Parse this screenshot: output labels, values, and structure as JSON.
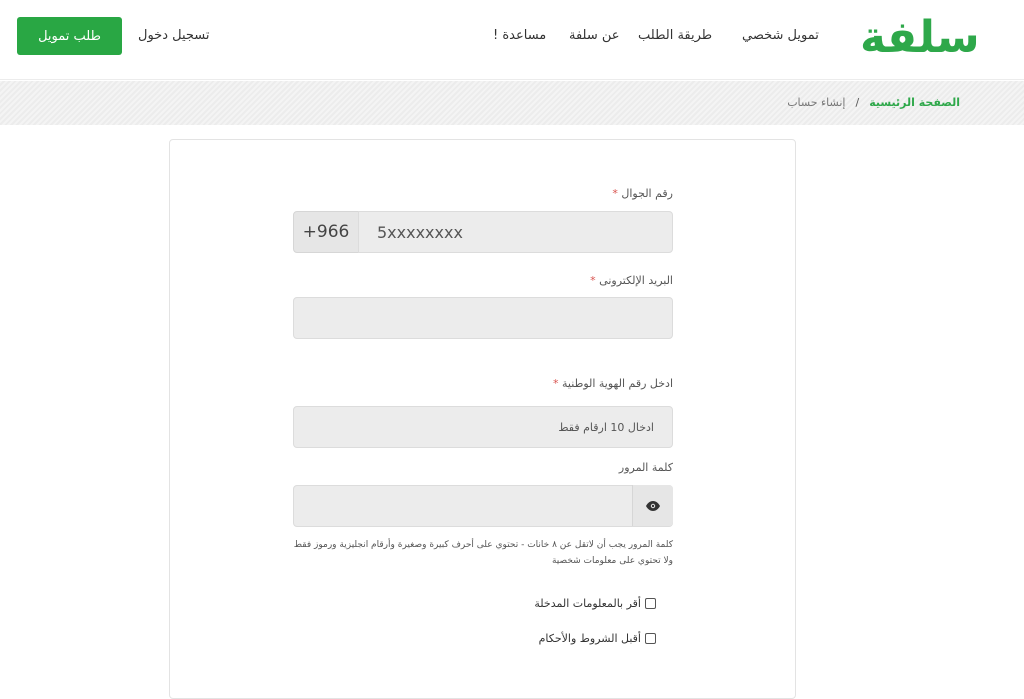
{
  "header": {
    "logo_text": "سلفة",
    "nav": [
      "تمويل شخصي",
      "طريقة الطلب",
      "عن سلفة",
      "مساعدة !"
    ],
    "login_label": "تسجيل دخول",
    "cta_label": "طلب تمويل"
  },
  "breadcrumb": {
    "home": "الصفحة الرئيسية",
    "separator": "/",
    "current": "إنشاء حساب"
  },
  "form": {
    "mobile_label": "رقم الجوال",
    "mobile_prefix": "+966",
    "mobile_placeholder": "5xxxxxxxx",
    "email_label": "البريد الإلكترونى",
    "email_value": "",
    "national_id_label": "ادخل رقم الهوية الوطنية",
    "national_id_placeholder": "ادخال 10 ارقام فقط",
    "password_label": "كلمة المرور",
    "password_value": "",
    "password_hint": "كلمة المرور يجب أن لاتقل عن ٨ خانات - تحتوي على أحرف كبيرة وصغيرة وأرقام انجليزية ورموز فقط ولا تحتوي على معلومات شخصية",
    "required_mark": "*",
    "confirm_info_label": "أقر بالمعلومات المدخلة",
    "accept_terms_label": "أقبل الشروط والأحكام",
    "eye_icon": "eye-icon"
  },
  "colors": {
    "brand_green": "#29a744",
    "required_red": "#d9534f"
  }
}
